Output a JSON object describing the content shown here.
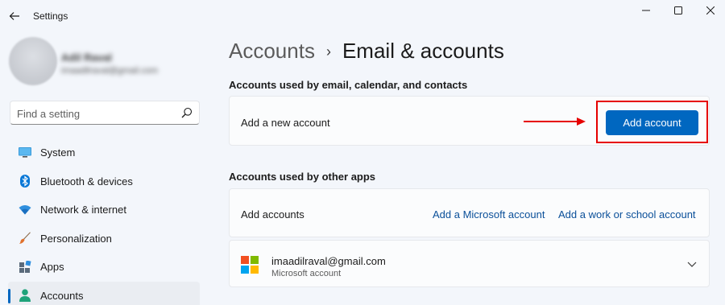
{
  "window": {
    "title": "Settings"
  },
  "profile": {
    "name": "Adil Raval",
    "email": "imaadilraval@gmail.com"
  },
  "search": {
    "placeholder": "Find a setting"
  },
  "sidebar": {
    "items": [
      {
        "label": "System",
        "icon": "monitor-icon"
      },
      {
        "label": "Bluetooth & devices",
        "icon": "bluetooth-icon"
      },
      {
        "label": "Network & internet",
        "icon": "wifi-icon"
      },
      {
        "label": "Personalization",
        "icon": "brush-icon"
      },
      {
        "label": "Apps",
        "icon": "apps-icon"
      },
      {
        "label": "Accounts",
        "icon": "person-icon",
        "active": true
      }
    ]
  },
  "breadcrumb": {
    "parent": "Accounts",
    "separator": "›",
    "current": "Email & accounts"
  },
  "sections": {
    "email": {
      "title": "Accounts used by email, calendar, and contacts",
      "row_label": "Add a new account",
      "button": "Add account"
    },
    "other_apps": {
      "title": "Accounts used by other apps",
      "row_label": "Add accounts",
      "link_microsoft": "Add a Microsoft account",
      "link_work": "Add a work or school account"
    }
  },
  "account": {
    "email": "imaadilraval@gmail.com",
    "type": "Microsoft account"
  },
  "colors": {
    "accent": "#0067c0",
    "highlight": "#e60000",
    "link": "#0a4f99"
  }
}
